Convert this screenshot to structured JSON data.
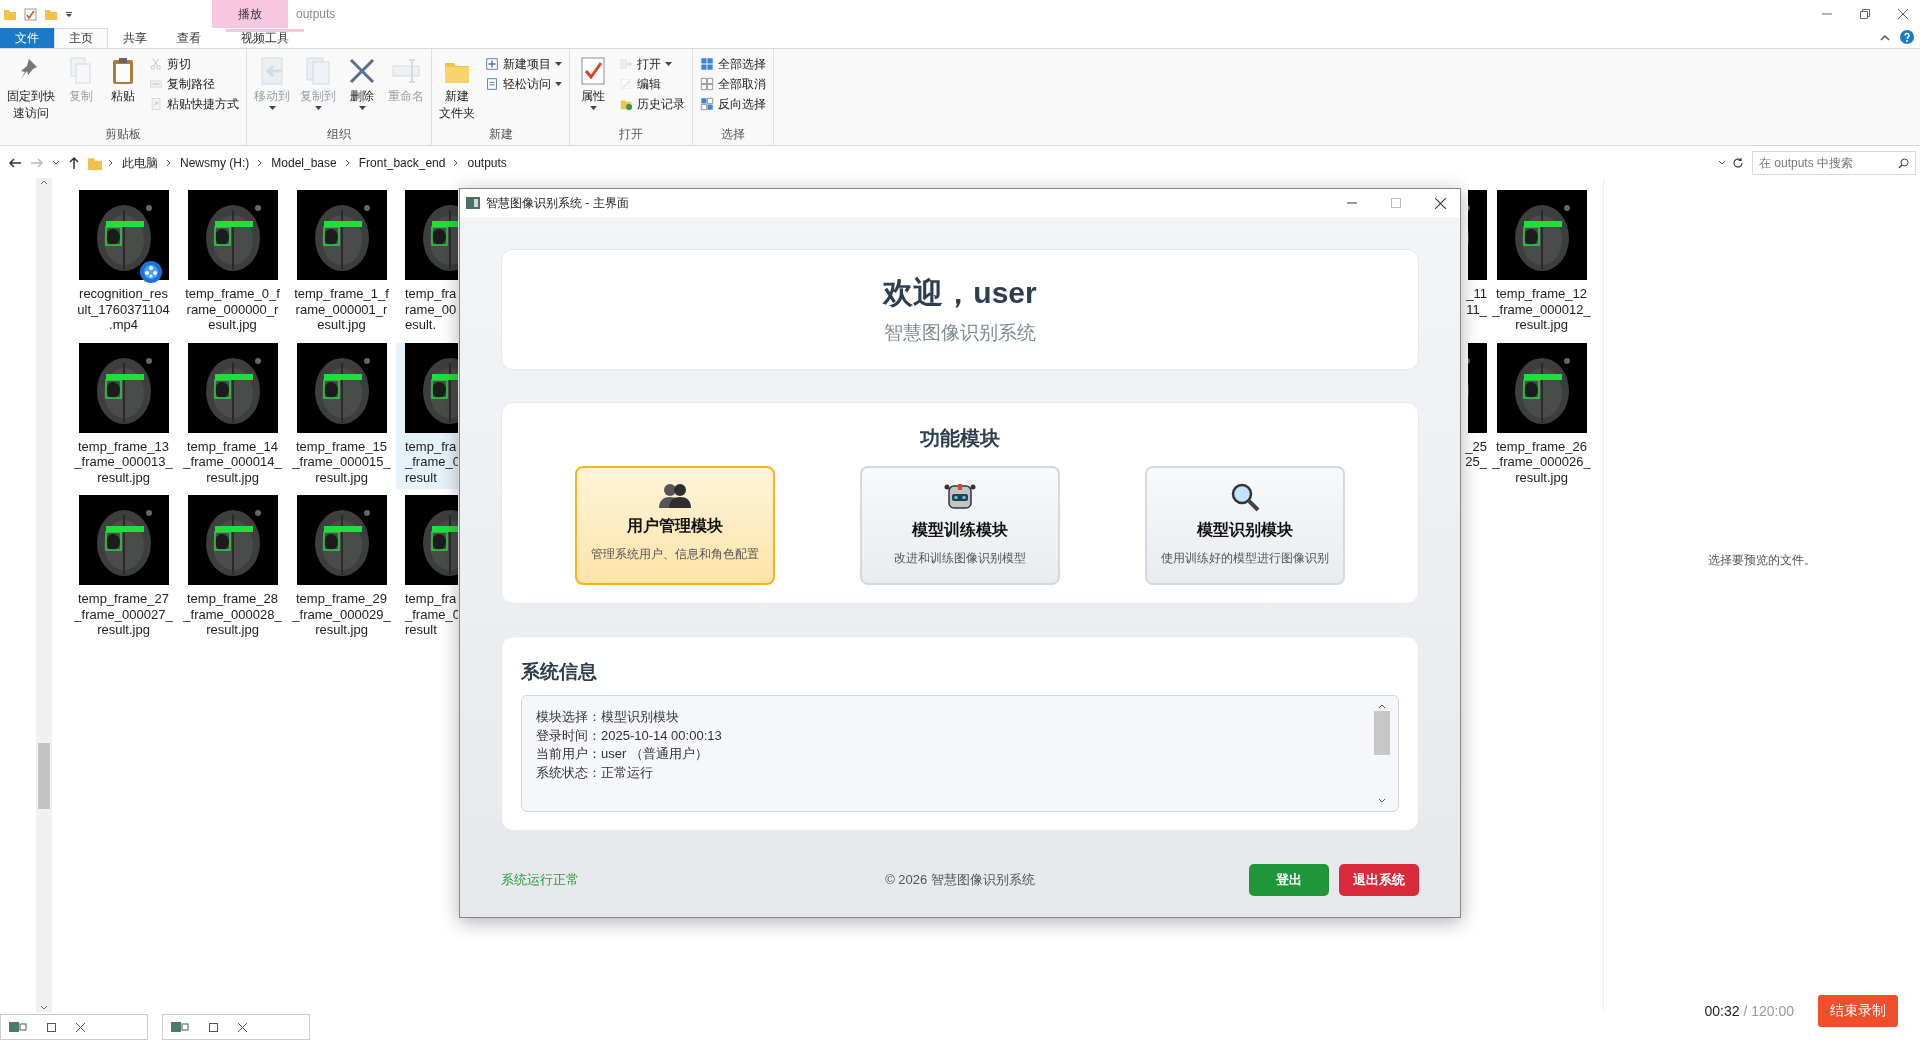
{
  "explorer": {
    "title": "outputs",
    "context_tab": "播放",
    "tabs": [
      {
        "label": "文件",
        "kind": "file",
        "selected": false
      },
      {
        "label": "主页",
        "kind": "tab",
        "selected": true
      },
      {
        "label": "共享",
        "kind": "tab",
        "selected": false
      },
      {
        "label": "查看",
        "kind": "tab",
        "selected": false
      },
      {
        "label": "视频工具",
        "kind": "context",
        "selected": false
      }
    ],
    "ribbon": [
      {
        "label": "剪贴板",
        "items": [
          {
            "kind": "large",
            "lines": [
              "固定到快",
              "速访问"
            ],
            "disabled": false,
            "dropdown": false
          },
          {
            "kind": "large",
            "lines": [
              "复制"
            ],
            "disabled": true,
            "dropdown": false
          },
          {
            "kind": "large",
            "lines": [
              "粘贴"
            ],
            "disabled": false,
            "dropdown": false
          },
          {
            "kind": "column",
            "rows": [
              {
                "label": "剪切",
                "disabled": true,
                "dropdown": false
              },
              {
                "label": "复制路径",
                "disabled": true,
                "dropdown": false
              },
              {
                "label": "粘贴快捷方式",
                "disabled": true,
                "dropdown": false
              }
            ]
          }
        ]
      },
      {
        "label": "组织",
        "items": [
          {
            "kind": "large",
            "lines": [
              "移动到"
            ],
            "disabled": true,
            "dropdown": true
          },
          {
            "kind": "large",
            "lines": [
              "复制到"
            ],
            "disabled": true,
            "dropdown": true
          },
          {
            "kind": "large",
            "lines": [
              "删除"
            ],
            "disabled": false,
            "dropdown": true
          },
          {
            "kind": "large",
            "lines": [
              "重命名"
            ],
            "disabled": true,
            "dropdown": false
          }
        ]
      },
      {
        "label": "新建",
        "items": [
          {
            "kind": "large",
            "lines": [
              "新建",
              "文件夹"
            ],
            "disabled": false,
            "dropdown": false
          },
          {
            "kind": "column",
            "rows": [
              {
                "label": "新建项目",
                "disabled": false,
                "dropdown": true
              },
              {
                "label": "轻松访问",
                "disabled": false,
                "dropdown": true
              }
            ]
          }
        ]
      },
      {
        "label": "打开",
        "items": [
          {
            "kind": "large",
            "lines": [
              "属性"
            ],
            "disabled": false,
            "dropdown": true
          },
          {
            "kind": "column",
            "rows": [
              {
                "label": "打开",
                "disabled": true,
                "dropdown": true
              },
              {
                "label": "编辑",
                "disabled": true,
                "dropdown": false
              },
              {
                "label": "历史记录",
                "disabled": false,
                "dropdown": false
              }
            ]
          }
        ]
      },
      {
        "label": "选择",
        "items": [
          {
            "kind": "column",
            "rows": [
              {
                "label": "全部选择",
                "disabled": false,
                "dropdown": false
              },
              {
                "label": "全部取消",
                "disabled": false,
                "dropdown": false
              },
              {
                "label": "反向选择",
                "disabled": false,
                "dropdown": false
              }
            ]
          }
        ]
      }
    ],
    "address": [
      "此电脑",
      "Newsmy (H:)",
      "Model_base",
      "Front_back_end",
      "outputs"
    ],
    "search": {
      "placeholder": "在 outputs 中搜索"
    },
    "files_left": [
      [
        {
          "kind": "video",
          "lines": [
            "recognition_res",
            "ult_1760371104",
            ".mp4"
          ],
          "selected": false
        },
        {
          "lines": [
            "temp_frame_0_f",
            "rame_000000_r",
            "esult.jpg"
          ],
          "selected": false
        },
        {
          "lines": [
            "temp_frame_1_f",
            "rame_000001_r",
            "esult.jpg"
          ],
          "selected": false
        },
        {
          "kind": "partial",
          "lines": [
            "temp_fra",
            "rame_00",
            "esult."
          ],
          "selected": false
        }
      ],
      [
        {
          "lines": [
            "temp_frame_13",
            "_frame_000013_",
            "result.jpg"
          ],
          "selected": false
        },
        {
          "lines": [
            "temp_frame_14",
            "_frame_000014_",
            "result.jpg"
          ],
          "selected": false
        },
        {
          "lines": [
            "temp_frame_15",
            "_frame_000015_",
            "result.jpg"
          ],
          "selected": false
        },
        {
          "kind": "partial",
          "lines": [
            "temp_fra",
            "_frame_0",
            "result"
          ],
          "selected": true
        }
      ],
      [
        {
          "lines": [
            "temp_frame_27",
            "_frame_000027_",
            "result.jpg"
          ],
          "selected": false
        },
        {
          "lines": [
            "temp_frame_28",
            "_frame_000028_",
            "result.jpg"
          ],
          "selected": false
        },
        {
          "lines": [
            "temp_frame_29",
            "_frame_000029_",
            "result.jpg"
          ],
          "selected": false
        },
        {
          "kind": "partial",
          "lines": [
            "temp_fra",
            "_frame_0",
            "result"
          ],
          "selected": false
        }
      ]
    ],
    "files_right": [
      [
        {
          "kind": "partial",
          "lines": [
            "_11",
            "11_"
          ],
          "selected": false
        },
        {
          "lines": [
            "temp_frame_12",
            "_frame_000012_",
            "result.jpg"
          ],
          "selected": false
        }
      ],
      [
        {
          "kind": "partial",
          "lines": [
            "_25",
            "25_"
          ],
          "selected": false
        },
        {
          "lines": [
            "temp_frame_26",
            "_frame_000026_",
            "result.jpg"
          ],
          "selected": false
        }
      ]
    ],
    "preview_hint": "选择要预览的文件。"
  },
  "app_window": {
    "title": "智慧图像识别系统 - 主界面",
    "welcome": "欢迎，user",
    "subtitle": "智慧图像识别系统",
    "modules_title": "功能模块",
    "modules": [
      {
        "title": "用户管理模块",
        "desc": "管理系统用户、信息和角色配置",
        "selected": true
      },
      {
        "title": "模型训练模块",
        "desc": "改进和训练图像识别模型",
        "selected": false
      },
      {
        "title": "模型识别模块",
        "desc": "使用训练好的模型进行图像识别",
        "selected": false
      }
    ],
    "info_title": "系统信息",
    "info_lines": [
      "模块选择：模型识别模块",
      "登录时间：2025-10-14 00:00:13",
      "当前用户：user （普通用户）",
      "系统状态：正常运行"
    ],
    "status": "系统运行正常",
    "copyright": "© 2026 智慧图像识别系统",
    "buttons": [
      {
        "label": "登出",
        "kind": "primary"
      },
      {
        "label": "退出系统",
        "kind": "danger"
      }
    ]
  },
  "recorder": {
    "elapsed": "00:32",
    "limit": "/ 120:00",
    "stop_button": "结束录制"
  }
}
